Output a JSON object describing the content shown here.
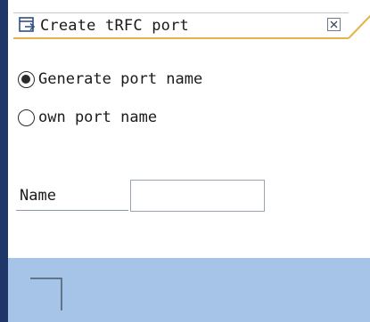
{
  "window": {
    "title": "Create tRFC port",
    "icon": "window-icon",
    "close_icon": "close-icon"
  },
  "port_name_options": [
    {
      "label": "Generate port name",
      "selected": true
    },
    {
      "label": "own port name",
      "selected": false
    }
  ],
  "name_field": {
    "label": "Name",
    "value": ""
  },
  "colors": {
    "frame": "#1f3668",
    "title_accent": "#e7b24a",
    "footer": "#a6c3e8"
  }
}
